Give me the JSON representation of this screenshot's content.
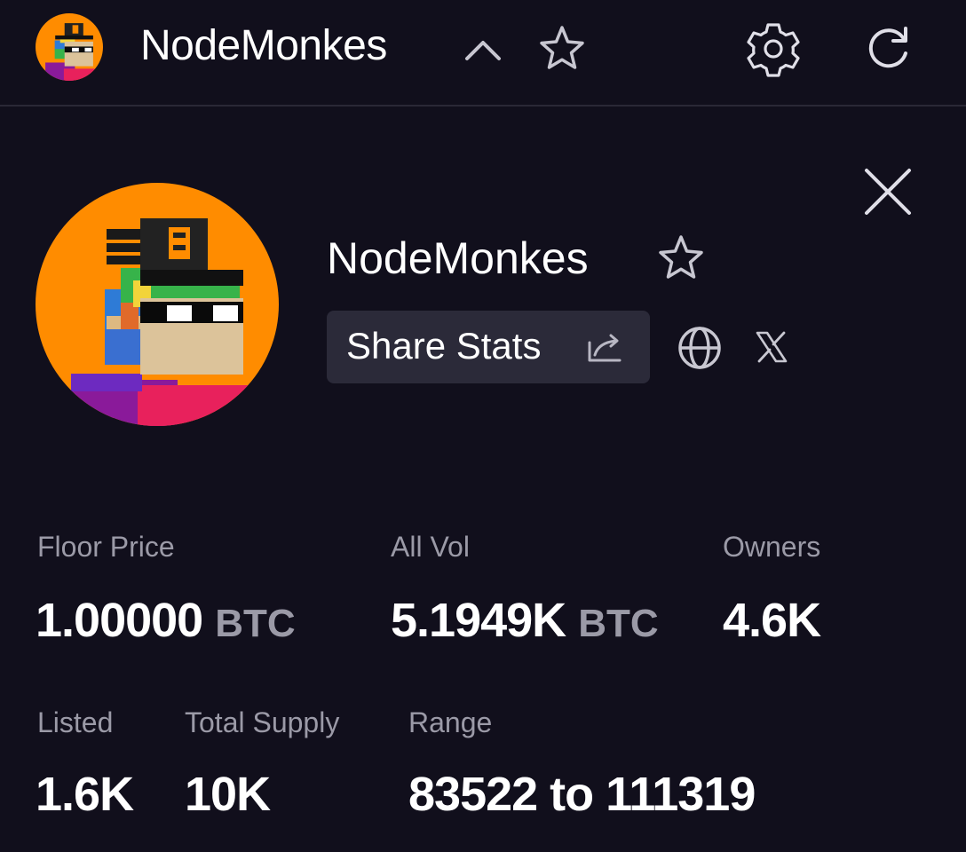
{
  "header": {
    "title": "NodeMonkes",
    "icons": {
      "avatar": "nodemonkes-avatar",
      "collapse": "chevron-up-icon",
      "favorite": "star-icon",
      "settings": "gear-icon",
      "refresh": "refresh-icon"
    }
  },
  "collection": {
    "name": "NodeMonkes",
    "share_label": "Share Stats",
    "icons": {
      "close": "close-icon",
      "favorite": "star-icon",
      "share": "share-icon",
      "website": "globe-icon",
      "social": "x-logo-icon"
    }
  },
  "stats": {
    "floor_price": {
      "label": "Floor Price",
      "value": "1.00000",
      "unit": "BTC"
    },
    "all_vol": {
      "label": "All Vol",
      "value": "5.1949K",
      "unit": "BTC"
    },
    "owners": {
      "label": "Owners",
      "value": "4.6K"
    },
    "listed": {
      "label": "Listed",
      "value": "1.6K"
    },
    "total_supply": {
      "label": "Total Supply",
      "value": "10K"
    },
    "range": {
      "label": "Range",
      "value": "83522 to 111319"
    }
  },
  "colors": {
    "background": "#110f1c",
    "surface": "#2b2a39",
    "muted_text": "#9b9aa7",
    "avatar_orange": "#ff8c00",
    "text": "#ffffff"
  }
}
